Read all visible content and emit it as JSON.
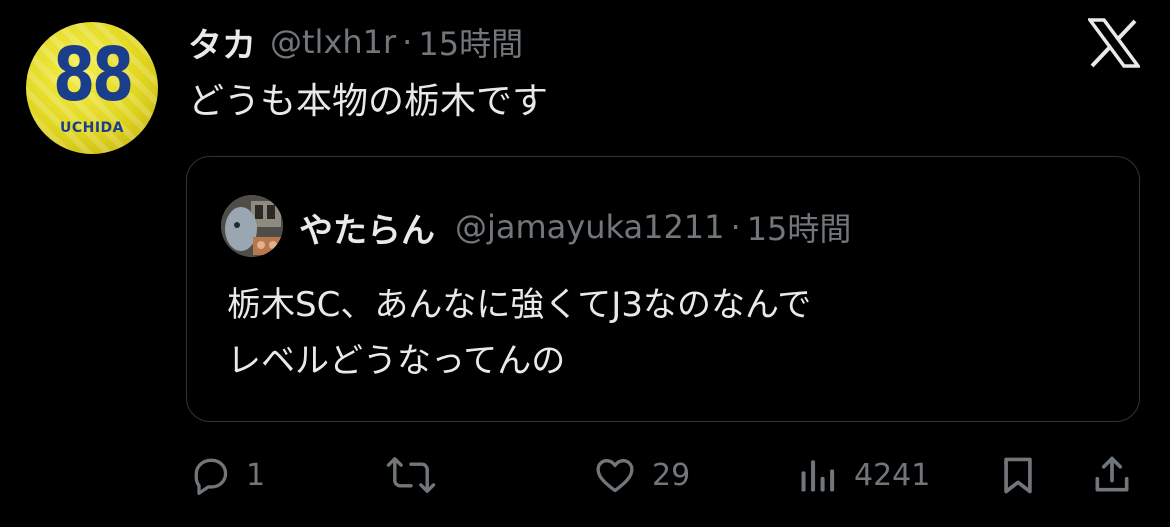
{
  "tweet": {
    "avatar": {
      "number": "88",
      "name": "UCHIDA",
      "colors": {
        "bg": "#e0d520",
        "text": "#1b3e8c"
      }
    },
    "display_name": "タカ",
    "handle": "@tlxh1r",
    "separator": "·",
    "time": "15時間",
    "text": "どうも本物の栃木です"
  },
  "quote": {
    "display_name": "やたらん",
    "handle": "@jamayuka1211",
    "separator": "·",
    "time": "15時間",
    "lines": [
      "栃木SC、あんなに強くてJ3なのなんで",
      "レベルどうなってんの"
    ]
  },
  "actions": {
    "reply": {
      "icon": "reply-icon",
      "count": "1"
    },
    "repost": {
      "icon": "repost-icon",
      "count": ""
    },
    "like": {
      "icon": "heart-icon",
      "count": "29"
    },
    "views": {
      "icon": "views-icon",
      "count": "4241"
    },
    "bookmark": {
      "icon": "bookmark-icon"
    },
    "share": {
      "icon": "share-icon"
    }
  },
  "logo": {
    "icon": "x-logo-icon"
  },
  "theme": {
    "background": "#000000",
    "text": "#e7e9ea",
    "muted": "#71767b",
    "border": "#2f3336"
  }
}
